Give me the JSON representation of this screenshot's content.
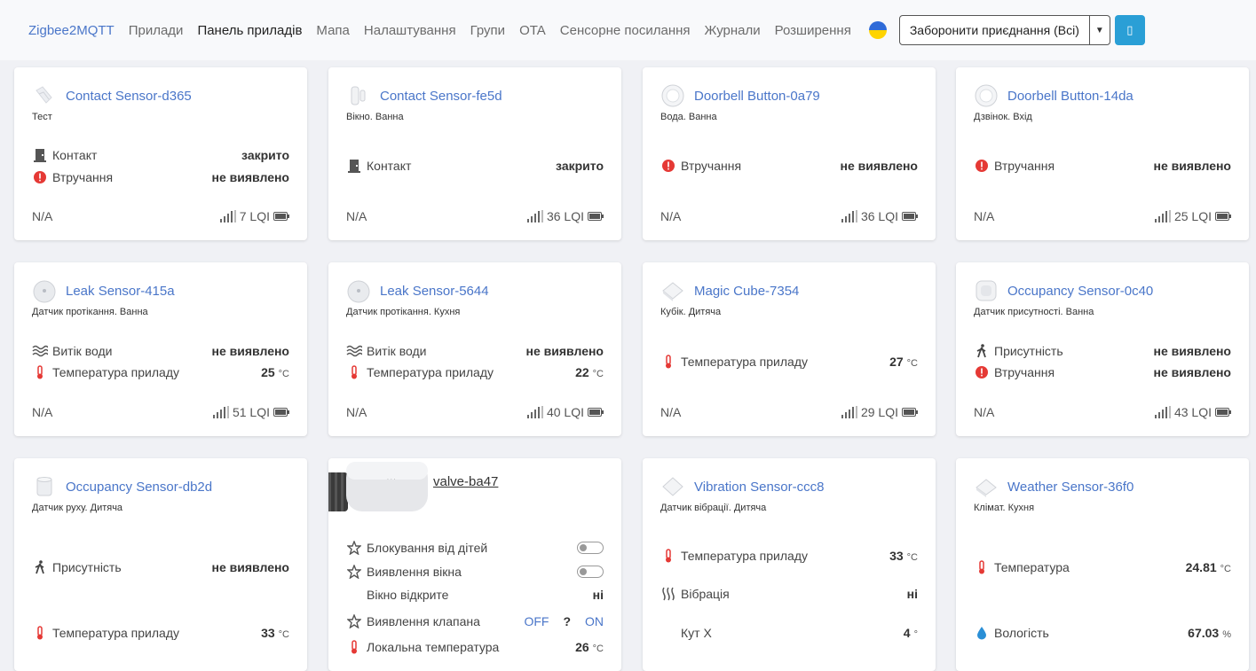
{
  "nav": {
    "brand": "Zigbee2MQTT",
    "links": [
      "Прилади",
      "Панель приладів",
      "Мапа",
      "Налаштування",
      "Групи",
      "OTA",
      "Сенсорне посилання",
      "Журнали",
      "Розширення"
    ],
    "active_index": 1,
    "permit_join": "Заборонити приєднання (Всі)",
    "theme_button": "▯"
  },
  "colors": {
    "accent": "#4a76c9",
    "button": "#2a9fd6",
    "error": "#e53935"
  },
  "cards": [
    {
      "name": "Contact Sensor-d365",
      "subtitle": "Тест",
      "icon": "contact-sensor-icon",
      "props": [
        {
          "label": "Контакт",
          "value": "закрито",
          "icon": "door-icon"
        },
        {
          "label": "Втручання",
          "value": "не виявлено",
          "icon": "alert-circle-icon"
        }
      ],
      "footer": {
        "status": "N/A",
        "lqi": "7 LQI"
      }
    },
    {
      "name": "Contact Sensor-fe5d",
      "subtitle": "Вікно. Ванна",
      "icon": "contact-sensor-icon",
      "props": [
        {
          "label": "Контакт",
          "value": "закрито",
          "icon": "door-icon"
        }
      ],
      "footer": {
        "status": "N/A",
        "lqi": "36 LQI"
      }
    },
    {
      "name": "Doorbell Button-0a79",
      "subtitle": "Вода. Ванна",
      "icon": "round-button-icon",
      "props": [
        {
          "label": "Втручання",
          "value": "не виявлено",
          "icon": "alert-circle-icon"
        }
      ],
      "footer": {
        "status": "N/A",
        "lqi": "36 LQI"
      }
    },
    {
      "name": "Doorbell Button-14da",
      "subtitle": "Дзвінок. Вхід",
      "icon": "round-button-icon",
      "props": [
        {
          "label": "Втручання",
          "value": "не виявлено",
          "icon": "alert-circle-icon"
        }
      ],
      "footer": {
        "status": "N/A",
        "lqi": "25 LQI"
      }
    },
    {
      "name": "Leak Sensor-415a",
      "subtitle": "Датчик протікання. Ванна",
      "icon": "leak-sensor-icon",
      "props": [
        {
          "label": "Витік води",
          "value": "не виявлено",
          "icon": "water-waves-icon"
        },
        {
          "label": "Температура приладу",
          "value": "25",
          "unit": "°C",
          "icon": "thermometer-icon"
        }
      ],
      "footer": {
        "status": "N/A",
        "lqi": "51 LQI"
      }
    },
    {
      "name": "Leak Sensor-5644",
      "subtitle": "Датчик протікання. Кухня",
      "icon": "leak-sensor-icon",
      "props": [
        {
          "label": "Витік води",
          "value": "не виявлено",
          "icon": "water-waves-icon"
        },
        {
          "label": "Температура приладу",
          "value": "22",
          "unit": "°C",
          "icon": "thermometer-icon"
        }
      ],
      "footer": {
        "status": "N/A",
        "lqi": "40 LQI"
      }
    },
    {
      "name": "Magic Cube-7354",
      "subtitle": "Кубік. Дитяча",
      "icon": "cube-icon",
      "props": [
        {
          "label": "Температура приладу",
          "value": "27",
          "unit": "°C",
          "icon": "thermometer-icon"
        }
      ],
      "footer": {
        "status": "N/A",
        "lqi": "29 LQI"
      }
    },
    {
      "name": "Occupancy Sensor-0c40",
      "subtitle": "Датчик присутності. Ванна",
      "icon": "occupancy-sensor-icon",
      "props": [
        {
          "label": "Присутність",
          "value": "не виявлено",
          "icon": "walking-person-icon"
        },
        {
          "label": "Втручання",
          "value": "не виявлено",
          "icon": "alert-circle-icon"
        }
      ],
      "footer": {
        "status": "N/A",
        "lqi": "43 LQI"
      }
    },
    {
      "name": "Occupancy Sensor-db2d",
      "subtitle": "Датчик руху. Дитяча",
      "icon": "cylinder-sensor-icon",
      "props": [
        {
          "label": "Присутність",
          "value": "не виявлено",
          "icon": "walking-person-icon"
        },
        {
          "label": "Температура приладу",
          "value": "33",
          "unit": "°C",
          "icon": "thermometer-icon"
        }
      ]
    },
    {
      "name": "valve-ba47",
      "subtitle": "",
      "icon": "thermostat-valve-icon",
      "props": [
        {
          "label": "Блокування від дітей",
          "icon": "star-icon",
          "control": "toggle"
        },
        {
          "label": "Виявлення вікна",
          "icon": "star-icon",
          "control": "toggle"
        },
        {
          "label": "Вікно відкрите",
          "value": "ні",
          "icon": ""
        },
        {
          "label": "Виявлення клапана",
          "icon": "star-icon",
          "options": [
            "OFF",
            "?",
            "ON"
          ]
        },
        {
          "label": "Локальна температура",
          "value": "26",
          "unit": "°C",
          "icon": "thermometer-icon"
        }
      ]
    },
    {
      "name": "Vibration Sensor-ccc8",
      "subtitle": "Датчик вібрації. Дитяча",
      "icon": "vibration-sensor-icon",
      "props": [
        {
          "label": "Температура приладу",
          "value": "33",
          "unit": "°C",
          "icon": "thermometer-icon"
        },
        {
          "label": "Вібрація",
          "value": "ні",
          "icon": "vibration-icon"
        },
        {
          "label": "Кут X",
          "value": "4",
          "unit": "°",
          "icon": ""
        }
      ]
    },
    {
      "name": "Weather Sensor-36f0",
      "subtitle": "Клімат. Кухня",
      "icon": "weather-sensor-icon",
      "props": [
        {
          "label": "Температура",
          "value": "24.81",
          "unit": "°C",
          "icon": "thermometer-icon"
        },
        {
          "label": "Вологість",
          "value": "67.03",
          "unit": "%",
          "icon": "water-drop-icon"
        }
      ]
    }
  ]
}
